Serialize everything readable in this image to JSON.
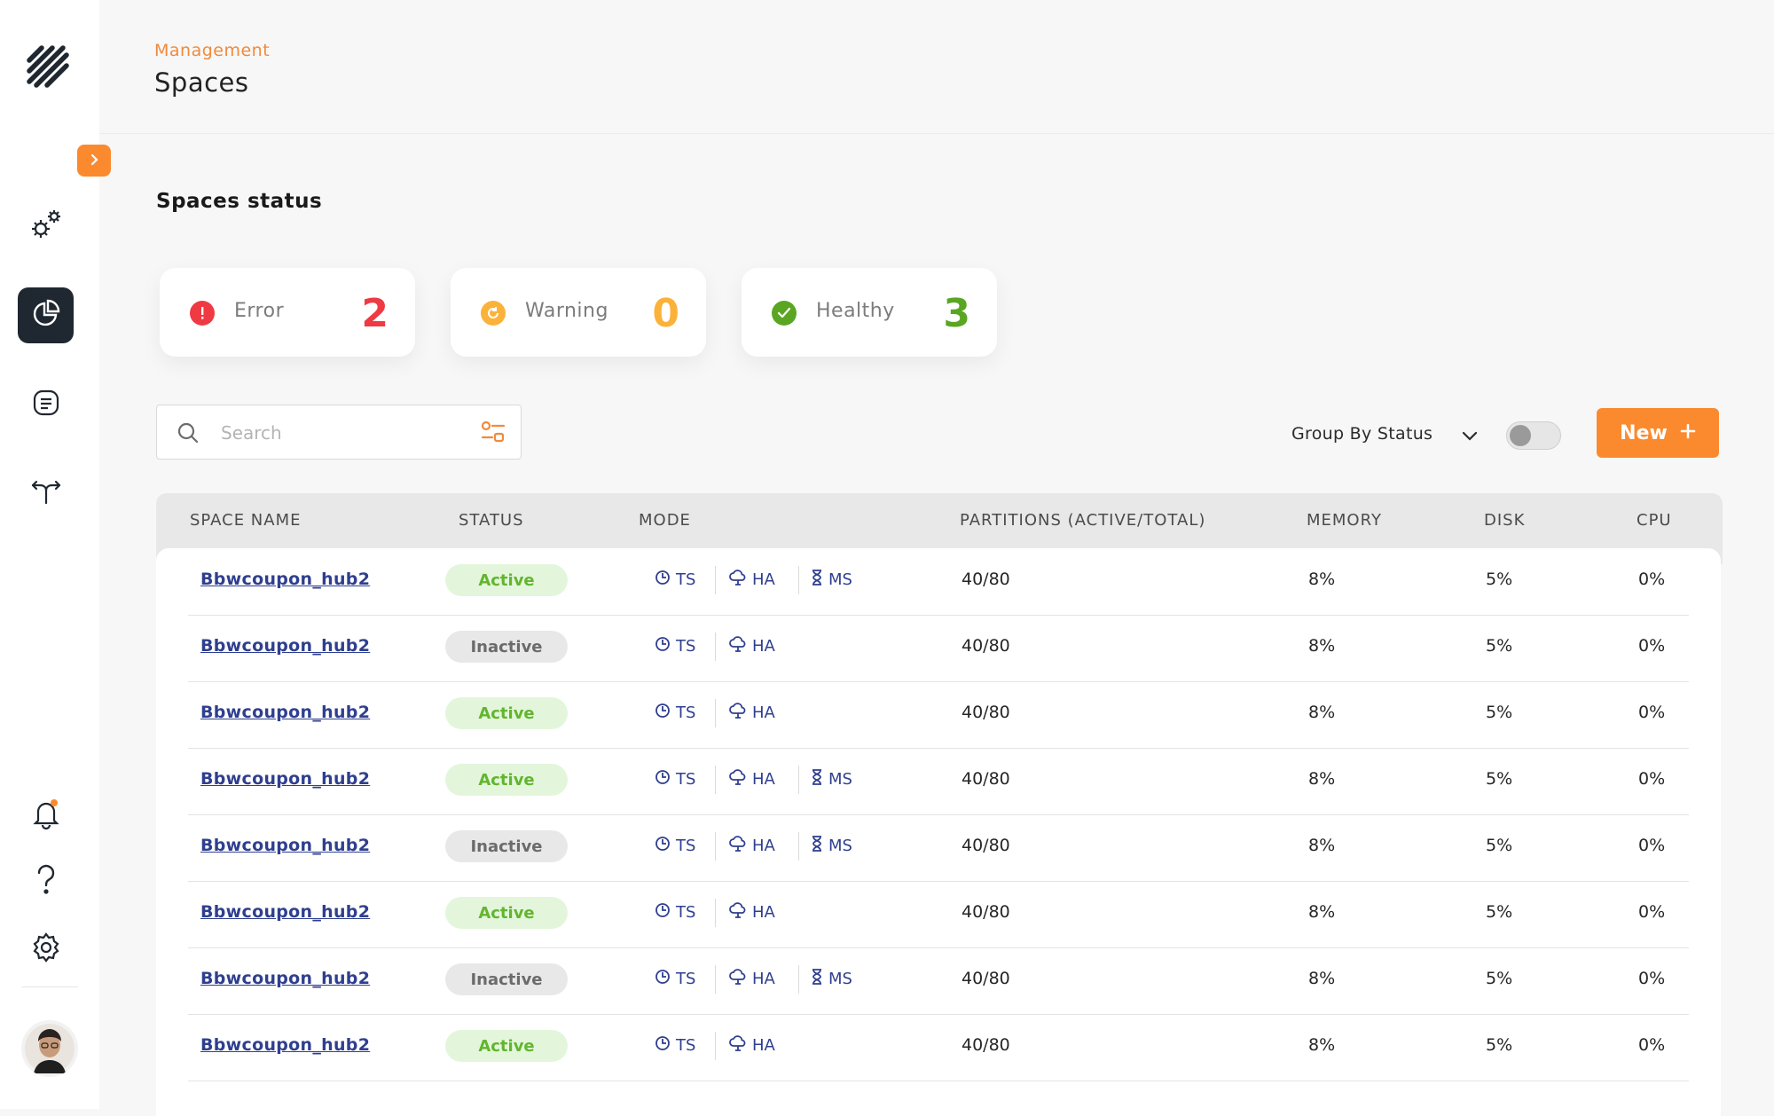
{
  "header": {
    "breadcrumb": "Management",
    "title": "Spaces"
  },
  "sidebar": {
    "items": [
      {
        "name": "gears-icon"
      },
      {
        "name": "dashboard-icon",
        "active": true
      },
      {
        "name": "document-icon"
      },
      {
        "name": "split-arrow-icon"
      },
      {
        "name": "bell-icon"
      },
      {
        "name": "help-icon"
      },
      {
        "name": "settings-icon"
      }
    ]
  },
  "section": {
    "title": "Spaces status"
  },
  "status_cards": [
    {
      "label": "Error",
      "count": "2",
      "color": "#ef3a43"
    },
    {
      "label": "Warning",
      "count": "0",
      "color": "#fbb23a"
    },
    {
      "label": "Healthy",
      "count": "3",
      "color": "#5aa623"
    }
  ],
  "toolbar": {
    "search_placeholder": "Search",
    "group_by": "Group By Status",
    "new_label": "New"
  },
  "table": {
    "columns": [
      "SPACE NAME",
      "STATUS",
      "MODE",
      "PARTITIONS (ACTIVE/TOTAL)",
      "MEMORY",
      "DISK",
      "CPU"
    ],
    "rows": [
      {
        "name": "Bbwcoupon_hub2",
        "status": "Active",
        "modes": [
          "TS",
          "HA",
          "MS"
        ],
        "partitions": "40/80",
        "memory": "8%",
        "disk": "5%",
        "cpu": "0%"
      },
      {
        "name": "Bbwcoupon_hub2",
        "status": "Inactive",
        "modes": [
          "TS",
          "HA"
        ],
        "partitions": "40/80",
        "memory": "8%",
        "disk": "5%",
        "cpu": "0%"
      },
      {
        "name": "Bbwcoupon_hub2",
        "status": "Active",
        "modes": [
          "TS",
          "HA"
        ],
        "partitions": "40/80",
        "memory": "8%",
        "disk": "5%",
        "cpu": "0%"
      },
      {
        "name": "Bbwcoupon_hub2",
        "status": "Active",
        "modes": [
          "TS",
          "HA",
          "MS"
        ],
        "partitions": "40/80",
        "memory": "8%",
        "disk": "5%",
        "cpu": "0%"
      },
      {
        "name": "Bbwcoupon_hub2",
        "status": "Inactive",
        "modes": [
          "TS",
          "HA",
          "MS"
        ],
        "partitions": "40/80",
        "memory": "8%",
        "disk": "5%",
        "cpu": "0%"
      },
      {
        "name": "Bbwcoupon_hub2",
        "status": "Active",
        "modes": [
          "TS",
          "HA"
        ],
        "partitions": "40/80",
        "memory": "8%",
        "disk": "5%",
        "cpu": "0%"
      },
      {
        "name": "Bbwcoupon_hub2",
        "status": "Inactive",
        "modes": [
          "TS",
          "HA",
          "MS"
        ],
        "partitions": "40/80",
        "memory": "8%",
        "disk": "5%",
        "cpu": "0%"
      },
      {
        "name": "Bbwcoupon_hub2",
        "status": "Active",
        "modes": [
          "TS",
          "HA"
        ],
        "partitions": "40/80",
        "memory": "8%",
        "disk": "5%",
        "cpu": "0%"
      }
    ]
  },
  "colors": {
    "accent": "#fb8a2f",
    "link": "#2f3f8f",
    "active_bg": "#e3f6dc",
    "active_fg": "#63b52f",
    "inactive_bg": "#e8e8e8",
    "inactive_fg": "#6b6b6b"
  }
}
